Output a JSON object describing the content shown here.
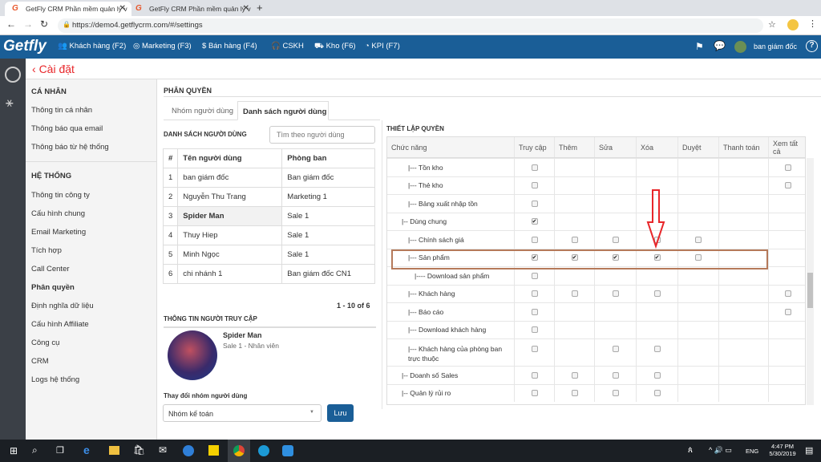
{
  "browser": {
    "tabs": [
      "GetFly CRM Phần mềm quản lý v",
      "GetFly CRM Phần mềm quản lý v"
    ],
    "url": "https://demo4.getflycrm.com/#/settings"
  },
  "nav": {
    "logo": "Getfly",
    "items": [
      "Khách hàng (F2)",
      "Marketing (F3)",
      "Bán hàng (F4)",
      "CSKH",
      "Kho (F6)",
      "KPI (F7)"
    ],
    "user": "ban giám đốc"
  },
  "header": {
    "title": "Cài đặt"
  },
  "sidebar": {
    "personal_heading": "CÁ NHÂN",
    "personal": [
      "Thông tin cá nhân",
      "Thông báo qua email",
      "Thông báo từ hệ thống"
    ],
    "system_heading": "HỆ THỐNG",
    "system": [
      "Thông tin công ty",
      "Cấu hình chung",
      "Email Marketing",
      "Tích hợp",
      "Call Center",
      "Phân quyền",
      "Định nghĩa dữ liệu",
      "Cấu hình Affiliate",
      "Công cụ",
      "CRM",
      "Logs hệ thống"
    ],
    "active": "Phân quyền"
  },
  "section": {
    "title": "PHÂN QUYỀN",
    "tabs": [
      "Nhóm người dùng",
      "Danh sách người dùng"
    ],
    "active_tab": "Danh sách người dùng"
  },
  "users": {
    "heading": "DANH SÁCH NGƯỜI DÙNG",
    "search_placeholder": "Tìm theo người dùng",
    "columns": [
      "#",
      "Tên người dùng",
      "Phòng ban"
    ],
    "rows": [
      [
        "1",
        "ban giám đốc",
        "Ban giám đốc"
      ],
      [
        "2",
        "Nguyễn Thu Trang",
        "Marketing 1"
      ],
      [
        "3",
        "Spider Man",
        "Sale 1"
      ],
      [
        "4",
        "Thuy Hiep",
        "Sale 1"
      ],
      [
        "5",
        "Minh Ngọc",
        "Sale 1"
      ],
      [
        "6",
        "chi nhánh 1",
        "Ban giám đốc CN1"
      ]
    ],
    "selected": "3",
    "pagination": "1 - 10 of 6"
  },
  "access": {
    "heading": "THÔNG TIN NGƯỜI TRUY CẬP",
    "name": "Spider Man",
    "role": "Sale 1 - Nhân viên",
    "change_label": "Thay đổi nhóm người dùng",
    "group": "Nhóm kế toán",
    "save": "Lưu"
  },
  "perms": {
    "heading": "THIẾT LẬP QUYỀN",
    "columns": [
      "Chức năng",
      "Truy cập",
      "Thêm",
      "Sửa",
      "Xóa",
      "Duyệt",
      "Thanh toán",
      "Xem tất cả"
    ],
    "rows": [
      {
        "label": "|--- Tồn kho",
        "indent": 2,
        "c": [
          false,
          null,
          null,
          null,
          null,
          null,
          false
        ]
      },
      {
        "label": "|--- Thẻ kho",
        "indent": 2,
        "c": [
          false,
          null,
          null,
          null,
          null,
          null,
          false
        ]
      },
      {
        "label": "|--- Bảng xuất nhập tồn",
        "indent": 2,
        "c": [
          false,
          null,
          null,
          null,
          null,
          null,
          null
        ]
      },
      {
        "label": "|-- Dùng chung",
        "indent": 1,
        "c": [
          true,
          null,
          null,
          null,
          null,
          null,
          null
        ]
      },
      {
        "label": "|--- Chính sách giá",
        "indent": 2,
        "c": [
          false,
          false,
          false,
          false,
          false,
          null,
          null
        ]
      },
      {
        "label": "|--- Sản phẩm",
        "indent": 2,
        "c": [
          true,
          true,
          true,
          true,
          false,
          null,
          null
        ],
        "highlighted": true
      },
      {
        "label": "|---- Download sản phẩm",
        "indent": 3,
        "c": [
          false,
          null,
          null,
          null,
          null,
          null,
          null
        ]
      },
      {
        "label": "|--- Khách hàng",
        "indent": 2,
        "c": [
          false,
          false,
          false,
          false,
          null,
          null,
          false
        ]
      },
      {
        "label": "|--- Báo cáo",
        "indent": 2,
        "c": [
          false,
          null,
          null,
          null,
          null,
          null,
          false
        ]
      },
      {
        "label": "|--- Download khách hàng",
        "indent": 2,
        "c": [
          false,
          null,
          null,
          null,
          null,
          null,
          null
        ]
      },
      {
        "label": "|--- Khách hàng của phòng ban trực thuộc",
        "indent": 2,
        "c": [
          false,
          null,
          false,
          false,
          null,
          null,
          null
        ],
        "tall": true
      },
      {
        "label": "|-- Doanh số Sales",
        "indent": 1,
        "c": [
          false,
          false,
          false,
          false,
          null,
          null,
          null
        ]
      },
      {
        "label": "|-- Quản lý rủi ro",
        "indent": 1,
        "c": [
          false,
          false,
          false,
          false,
          null,
          null,
          null
        ]
      }
    ]
  },
  "colors": {
    "nav": "#1a5e97",
    "accent_red": "#e8262a",
    "highlight_box": "#b5795a",
    "button": "#1a5e97"
  },
  "taskbar": {
    "time": "4:47 PM",
    "date": "5/30/2019",
    "lang": "ENG"
  }
}
